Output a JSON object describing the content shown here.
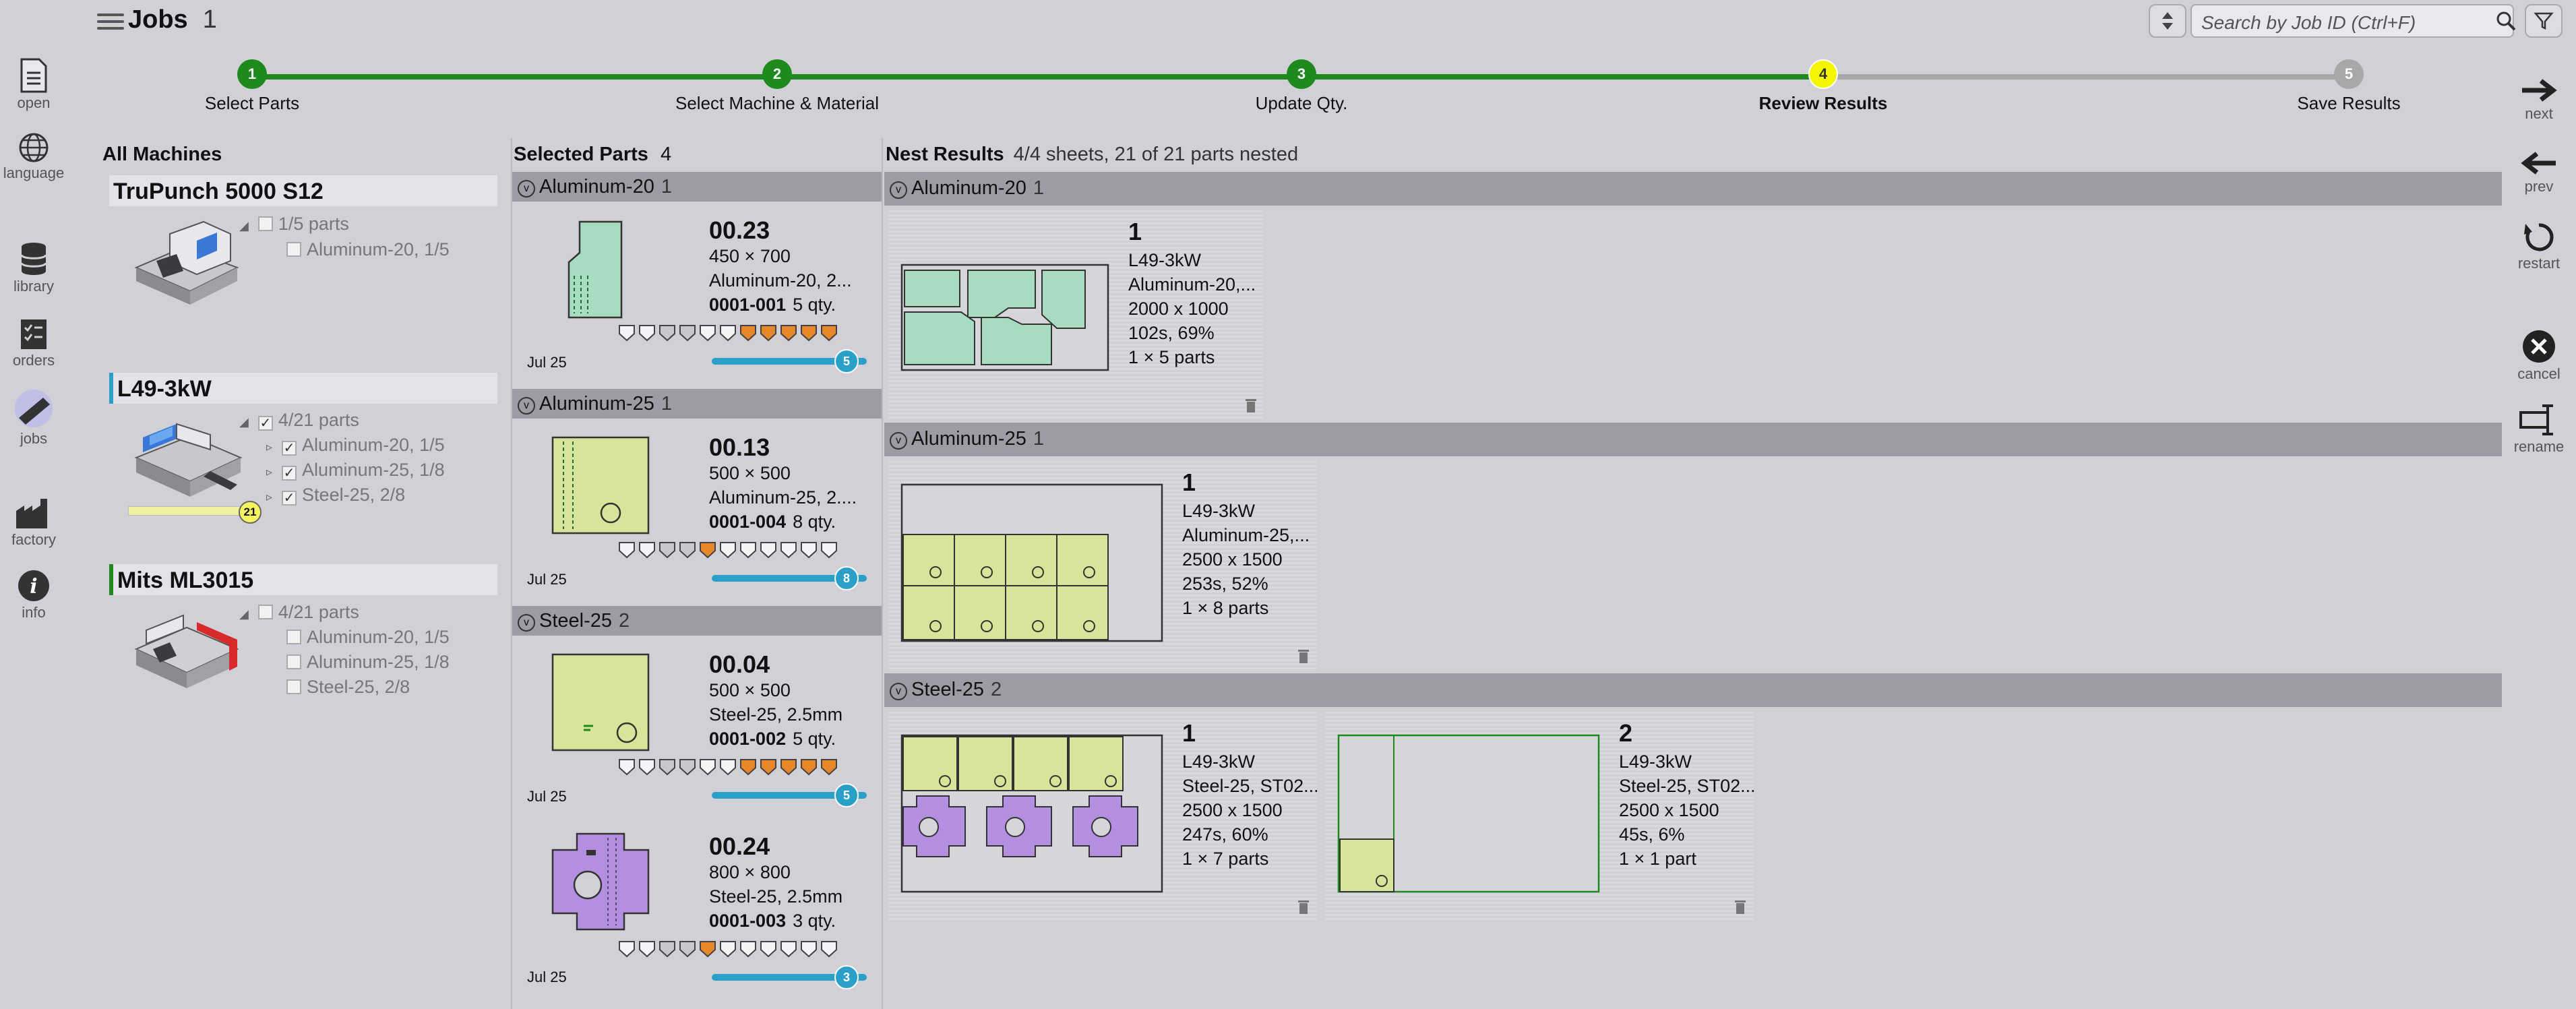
{
  "header": {
    "title": "Jobs",
    "job_count": "1",
    "search_placeholder": "Search by Job ID (Ctrl+F)"
  },
  "steps": [
    {
      "num": "1",
      "label": "Select Parts",
      "state": "done"
    },
    {
      "num": "2",
      "label": "Select Machine & Material",
      "state": "done"
    },
    {
      "num": "3",
      "label": "Update Qty.",
      "state": "done"
    },
    {
      "num": "4",
      "label": "Review Results",
      "state": "current"
    },
    {
      "num": "5",
      "label": "Save Results",
      "state": "todo"
    }
  ],
  "leftnav": [
    "open",
    "language",
    "library",
    "orders",
    "jobs",
    "factory",
    "info"
  ],
  "rightnav": [
    "next",
    "prev",
    "restart",
    "cancel",
    "rename"
  ],
  "machines": {
    "heading": "All Machines",
    "list": [
      {
        "name": "TruPunch 5000 S12",
        "summary": "1/5 parts",
        "items": [
          "Aluminum-20, 1/5"
        ]
      },
      {
        "name": "L49-3kW",
        "summary": "4/21 parts",
        "items": [
          "Aluminum-20, 1/5",
          "Aluminum-25, 1/8",
          "Steel-25, 2/8"
        ],
        "progress": "21"
      },
      {
        "name": "Mits ML3015",
        "summary": "4/21 parts",
        "items": [
          "Aluminum-20, 1/5",
          "Aluminum-25, 1/8",
          "Steel-25, 2/8"
        ]
      }
    ]
  },
  "selected_parts": {
    "heading": "Selected Parts",
    "count": "4",
    "groups": [
      {
        "name": "Aluminum-20",
        "count": "1",
        "parts": [
          {
            "id": "00.23",
            "dims": "450 × 700",
            "material": "Aluminum-20, 2...",
            "job": "0001-001",
            "qty": "5 qty.",
            "date": "Jul 25",
            "progress": "5"
          }
        ]
      },
      {
        "name": "Aluminum-25",
        "count": "1",
        "parts": [
          {
            "id": "00.13",
            "dims": "500 × 500",
            "material": "Aluminum-25, 2....",
            "job": "0001-004",
            "qty": "8 qty.",
            "date": "Jul 25",
            "progress": "8"
          }
        ]
      },
      {
        "name": "Steel-25",
        "count": "2",
        "parts": [
          {
            "id": "00.04",
            "dims": "500 × 500",
            "material": "Steel-25, 2.5mm",
            "job": "0001-002",
            "qty": "5 qty.",
            "date": "Jul 25",
            "progress": "5"
          },
          {
            "id": "00.24",
            "dims": "800 × 800",
            "material": "Steel-25, 2.5mm",
            "job": "0001-003",
            "qty": "3 qty.",
            "date": "Jul 25",
            "progress": "3"
          }
        ]
      }
    ]
  },
  "nest_results": {
    "heading": "Nest Results",
    "summary": "4/4 sheets, 21 of 21 parts nested",
    "groups": [
      {
        "name": "Aluminum-20",
        "count": "1",
        "sheets": [
          {
            "num": "1",
            "machine": "L49-3kW",
            "material": "Aluminum-20,...",
            "size": "2000 x 1000",
            "time": "102s, 69%",
            "parts": "1 × 5 parts"
          }
        ]
      },
      {
        "name": "Aluminum-25",
        "count": "1",
        "sheets": [
          {
            "num": "1",
            "machine": "L49-3kW",
            "material": "Aluminum-25,...",
            "size": "2500 x 1500",
            "time": "253s, 52%",
            "parts": "1 × 8 parts"
          }
        ]
      },
      {
        "name": "Steel-25",
        "count": "2",
        "sheets": [
          {
            "num": "1",
            "machine": "L49-3kW",
            "material": "Steel-25, ST02...",
            "size": "2500 x 1500",
            "time": "247s, 60%",
            "parts": "1 × 7 parts"
          },
          {
            "num": "2",
            "machine": "L49-3kW",
            "material": "Steel-25, ST02...",
            "size": "2500 x 1500",
            "time": "45s, 6%",
            "parts": "1 × 1 part"
          }
        ]
      }
    ]
  },
  "colors": {
    "done": "#1e8a1e",
    "current": "#f5f500",
    "todo": "#a8a8a8",
    "progress": "#2aa0c8",
    "alu20": "#a8dcc0",
    "alu25": "#d8e49a",
    "steel_lilac": "#b48ee0"
  }
}
